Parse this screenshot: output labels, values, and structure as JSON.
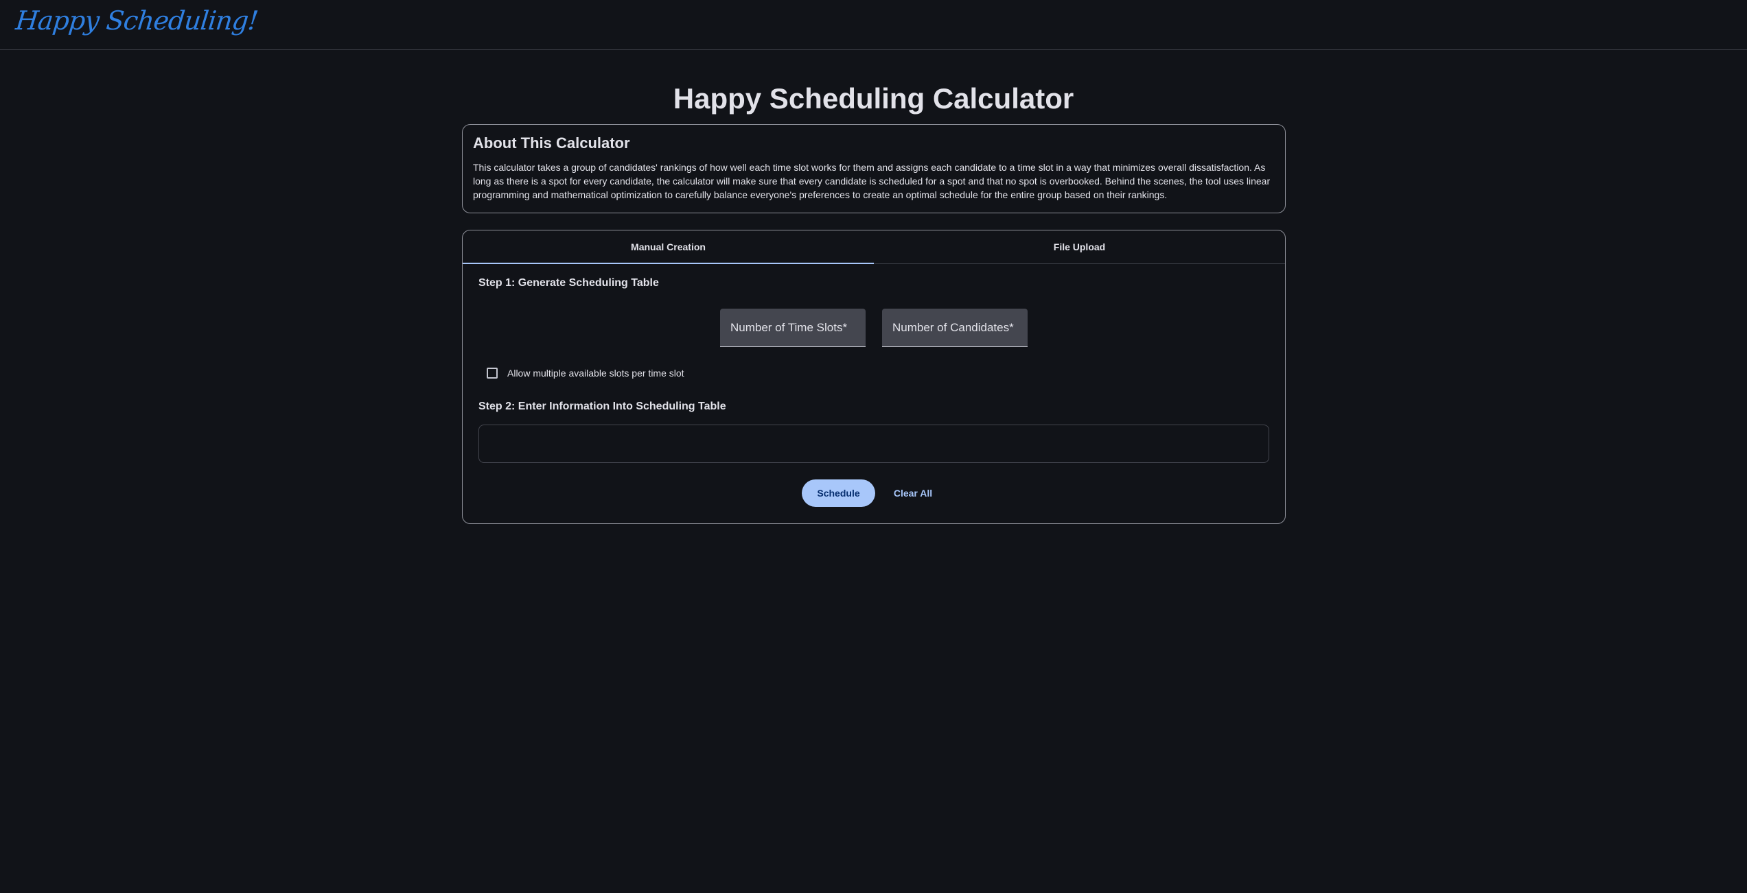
{
  "header": {
    "logo_text": "Happy Scheduling!"
  },
  "page": {
    "title": "Happy Scheduling Calculator"
  },
  "about": {
    "title": "About This Calculator",
    "text": "This calculator takes a group of candidates' rankings of how well each time slot works for them and assigns each candidate to a time slot in a way that minimizes overall dissatisfaction. As long as there is a spot for every candidate, the calculator will make sure that every candidate is scheduled for a spot and that no spot is overbooked. Behind the scenes, the tool uses linear programming and mathematical optimization to carefully balance everyone's preferences to create an optimal schedule for the entire group based on their rankings."
  },
  "tabs": [
    {
      "label": "Manual Creation",
      "active": true
    },
    {
      "label": "File Upload",
      "active": false
    }
  ],
  "step1": {
    "title": "Step 1: Generate Scheduling Table",
    "time_slots_label": "Number of Time Slots*",
    "candidates_label": "Number of Candidates*",
    "checkbox_label": "Allow multiple available slots per time slot",
    "checkbox_checked": false
  },
  "step2": {
    "title": "Step 2: Enter Information Into Scheduling Table"
  },
  "actions": {
    "schedule_label": "Schedule",
    "clear_label": "Clear All"
  },
  "colors": {
    "background": "#111318",
    "accent": "#a8c7fa",
    "logo": "#2f7fe0",
    "field_bg": "#44464f"
  }
}
